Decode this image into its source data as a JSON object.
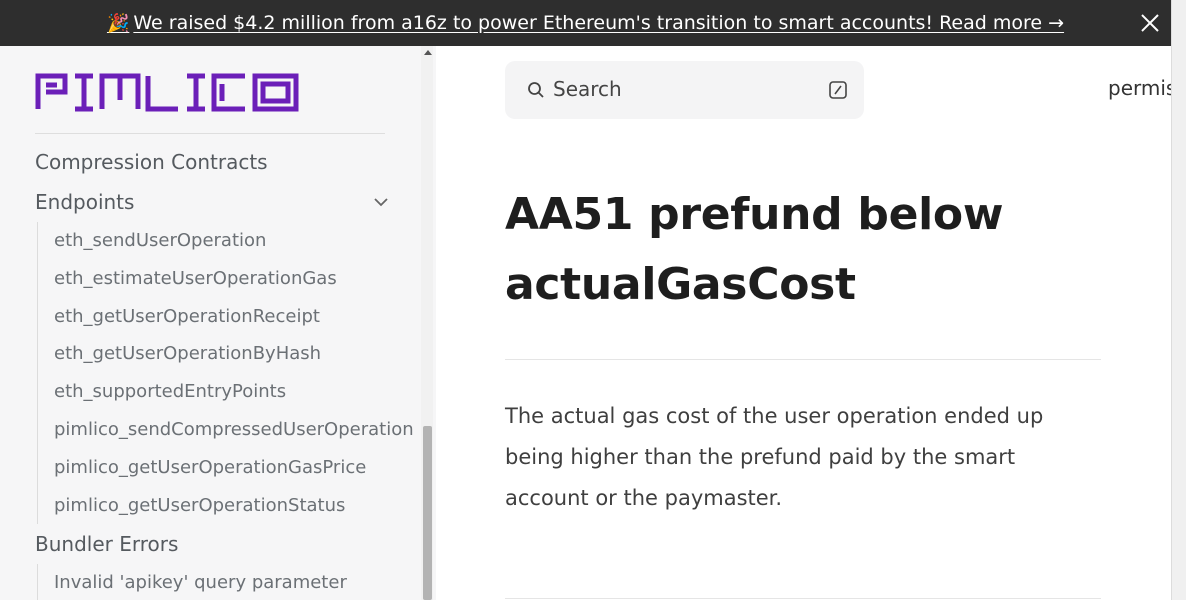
{
  "banner": {
    "emoji": "🎉",
    "text": "We raised $4.2 million from a16z to power Ethereum's transition to smart accounts! Read more →"
  },
  "logo": {
    "text": "PIMLICO",
    "color": "#6b1fb8"
  },
  "sidebar": {
    "sections": [
      {
        "label": "Compression Contracts",
        "expanded": false
      },
      {
        "label": "Endpoints",
        "expanded": true
      },
      {
        "label": "Bundler Errors",
        "expanded": true
      }
    ],
    "endpoints": [
      "eth_sendUserOperation",
      "eth_estimateUserOperationGas",
      "eth_getUserOperationReceipt",
      "eth_getUserOperationByHash",
      "eth_supportedEntryPoints",
      "pimlico_sendCompressedUserOperation",
      "pimlico_getUserOperationGasPrice",
      "pimlico_getUserOperationStatus"
    ],
    "bundler_errors": [
      "Invalid 'apikey' query parameter"
    ]
  },
  "search": {
    "placeholder": "Search"
  },
  "top_link": "permis",
  "article": {
    "title": "AA51 prefund below actualGasCost",
    "body": "The actual gas cost of the user operation ended up being higher than the prefund paid by the smart account or the paymaster."
  },
  "icons": {
    "search": "search-icon",
    "kbd": "keyboard-shortcut-icon",
    "close": "close-icon",
    "chevron": "chevron-down-icon"
  }
}
